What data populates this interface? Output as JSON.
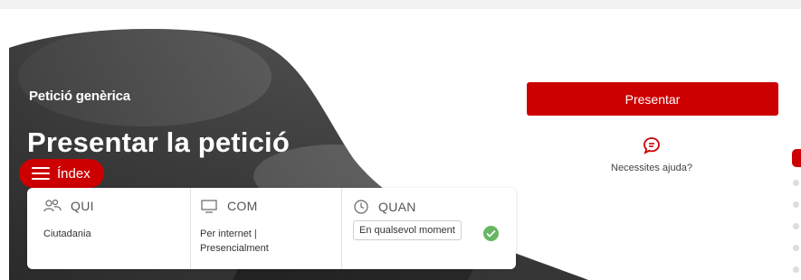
{
  "header": {
    "breadcrumb": "Petició genèrica",
    "title": "Presentar la petició"
  },
  "index_button": {
    "label": "Índex",
    "icon": "menu-icon"
  },
  "info_card": {
    "columns": [
      {
        "icon": "people-icon",
        "heading": "QUI",
        "value": "Ciutadania"
      },
      {
        "icon": "monitor-icon",
        "heading": "COM",
        "value_lines": [
          "Per internet |",
          "Presencialment"
        ]
      },
      {
        "icon": "clock-icon",
        "heading": "QUAN",
        "chip": "En qualsevol moment",
        "status_icon": "check-circle-icon"
      }
    ]
  },
  "actions": {
    "present_label": "Presentar",
    "help_label": "Necessites ajuda?",
    "help_icon": "chat-bubble-icon"
  },
  "colors": {
    "accent": "#cc0000",
    "success": "#67b663"
  }
}
